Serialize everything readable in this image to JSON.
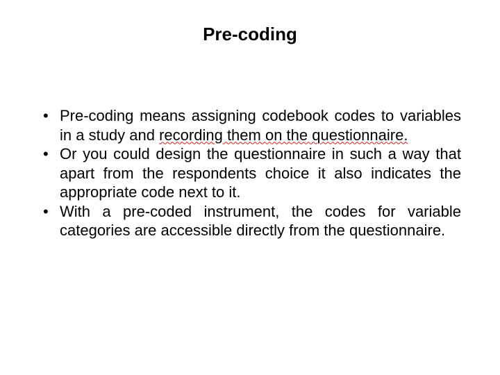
{
  "title": "Pre-coding",
  "bullets": [
    {
      "runs": [
        {
          "t": "Pre-coding means assigning codebook codes to variables in a study and "
        },
        {
          "t": "recording them on the questionnaire.",
          "err": true
        }
      ]
    },
    {
      "runs": [
        {
          "t": "Or you could design the questionnaire in such a way that apart from the respondents choice it also indicates the appropriate code next to it."
        }
      ]
    },
    {
      "runs": [
        {
          "t": "With a pre-coded instrument, the codes for variable categories are accessible directly from the questionnaire."
        }
      ]
    }
  ]
}
